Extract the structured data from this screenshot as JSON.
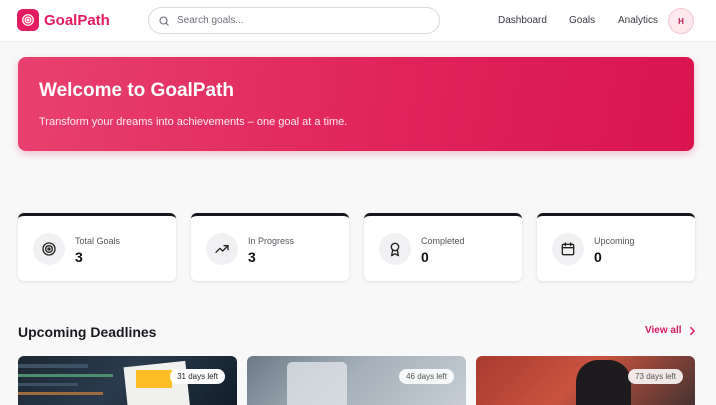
{
  "header": {
    "logo_text": "GoalPath",
    "search_placeholder": "Search goals...",
    "nav": [
      "Dashboard",
      "Goals",
      "Analytics"
    ],
    "avatar_initial": "H"
  },
  "hero": {
    "title": "Welcome to GoalPath",
    "subtitle": "Transform your dreams into achievements – one goal at a time."
  },
  "stats": [
    {
      "label": "Total Goals",
      "value": "3",
      "icon": "target-icon"
    },
    {
      "label": "In Progress",
      "value": "3",
      "icon": "trending-up-icon"
    },
    {
      "label": "Completed",
      "value": "0",
      "icon": "award-icon"
    },
    {
      "label": "Upcoming",
      "value": "0",
      "icon": "calendar-icon"
    }
  ],
  "deadlines": {
    "title": "Upcoming Deadlines",
    "view_all": "View all",
    "cards": [
      {
        "badge": "31 days left"
      },
      {
        "badge": "46 days left"
      },
      {
        "badge": "73 days left"
      }
    ]
  },
  "colors": {
    "accent": "#e31c5f",
    "hero_gradient_start": "#e8416f",
    "hero_gradient_end": "#d9144f"
  }
}
